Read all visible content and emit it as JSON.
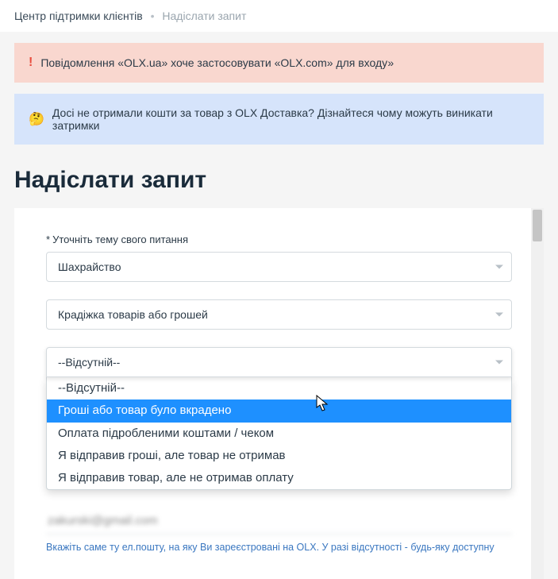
{
  "breadcrumb": {
    "root": "Центр підтримки клієнтів",
    "current": "Надіслати запит"
  },
  "banners": {
    "warn": "Повідомлення «OLX.ua» хоче застосовувати «OLX.com» для входу»",
    "info": "Досі не отримали кошти за товар з OLX Доставка? Дізнайтеся чому можуть виникати затримки"
  },
  "page_title": "Надіслати запит",
  "form": {
    "topic_label": "Уточніть тему свого питання",
    "required_mark": "*",
    "topic_value": "Шахрайство",
    "subtopic_value": "Крадіжка товарів або грошей",
    "detail_value": "--Відсутній--",
    "detail_options": [
      "--Відсутній--",
      "Гроші або товар було вкрадено",
      "Оплата підробленими коштами / чеком",
      "Я відправив гроші, але товар не отримав",
      "Я відправив товар, але не отримав оплату"
    ],
    "detail_highlight_index": 1,
    "email_value": "zakurski@gmail.com",
    "email_hint": "Вкажіть саме ту ел.пошту, на яку Ви зареєстровані на OLX. У разі відсутності - будь-яку доступну"
  }
}
